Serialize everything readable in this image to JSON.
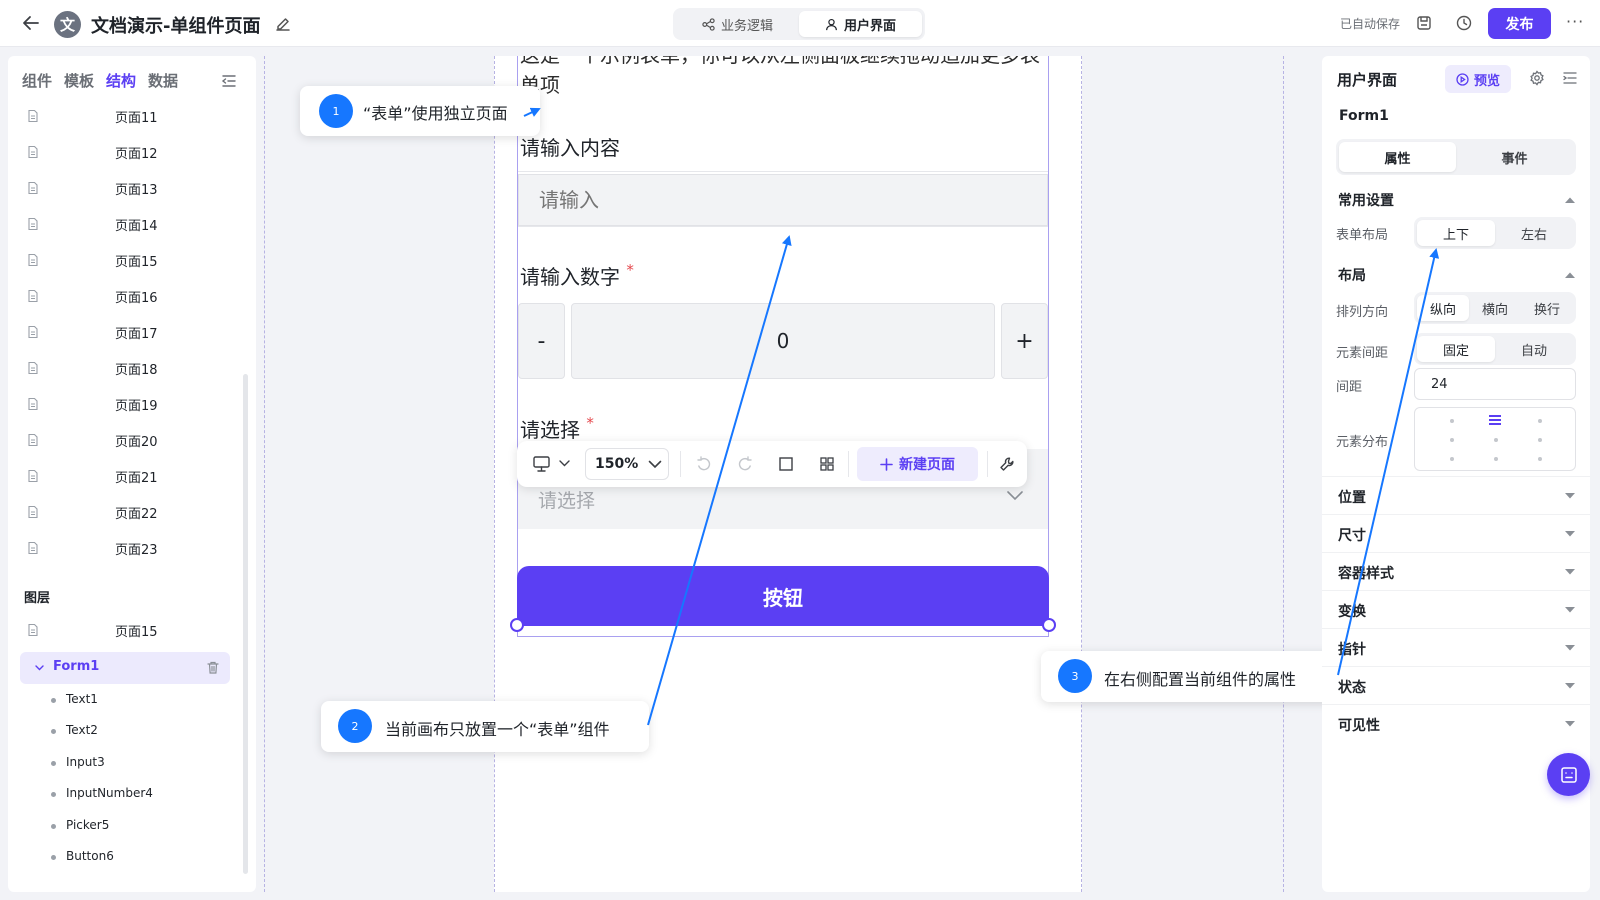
{
  "header": {
    "app_title": "文档演示-单组件页面",
    "logo_char": "文",
    "mode_tabs": [
      {
        "label": "业务逻辑",
        "icon": "flow-icon"
      },
      {
        "label": "用户界面",
        "icon": "user-icon"
      }
    ],
    "autosave_text": "已自动保存",
    "publish_label": "发布",
    "more_label": "···"
  },
  "left_panel": {
    "tabs": [
      "组件",
      "模板",
      "结构",
      "数据"
    ],
    "active_tab": "结构",
    "pages": [
      "页面11",
      "页面12",
      "页面13",
      "页面14",
      "页面15",
      "页面16",
      "页面17",
      "页面18",
      "页面19",
      "页面20",
      "页面21",
      "页面22",
      "页面23"
    ],
    "layers_title": "图层",
    "layer_page": "页面15",
    "layer_form": "Form1",
    "layer_children": [
      "Text1",
      "Text2",
      "Input3",
      "InputNumber4",
      "Picker5",
      "Button6"
    ]
  },
  "canvas": {
    "intro_text": "这是一个示例表单，你可以从左侧面板继续拖动追加更多表单项",
    "input_label": "请输入内容",
    "input_placeholder": "请输入",
    "number_label": "请输入数字",
    "number_value": "0",
    "minus_label": "-",
    "plus_label": "+",
    "required_mark": "*",
    "picker_label": "请选择",
    "picker_placeholder": "请选择",
    "button_label": "按钮",
    "toolbar": {
      "zoom": "150%",
      "new_page_label": "新建页面"
    }
  },
  "callouts": [
    {
      "num": "1",
      "text": "“表单”使用独立页面"
    },
    {
      "num": "2",
      "text": "当前画布只放置一个“表单”组件"
    },
    {
      "num": "3",
      "text": "在右侧配置当前组件的属性"
    }
  ],
  "right_panel": {
    "title": "用户界面",
    "preview_label": "预览",
    "component_name": "Form1",
    "tabs": [
      "属性",
      "事件"
    ],
    "common_section": "常用设置",
    "form_layout_label": "表单布局",
    "form_layout_options": [
      "上下",
      "左右"
    ],
    "layout_section": "布局",
    "direction_label": "排列方向",
    "direction_options": [
      "纵向",
      "横向",
      "换行"
    ],
    "spacing_label": "元素间距",
    "spacing_options": [
      "固定",
      "自动"
    ],
    "gap_label": "间距",
    "gap_value": "24",
    "distribution_label": "元素分布",
    "collapsed_sections": [
      "位置",
      "尺寸",
      "容器样式",
      "变换",
      "指针",
      "状态",
      "可见性"
    ]
  },
  "colors": {
    "accent": "#5b3ff3",
    "callout_blue": "#1677ff",
    "required": "#e5484d"
  }
}
